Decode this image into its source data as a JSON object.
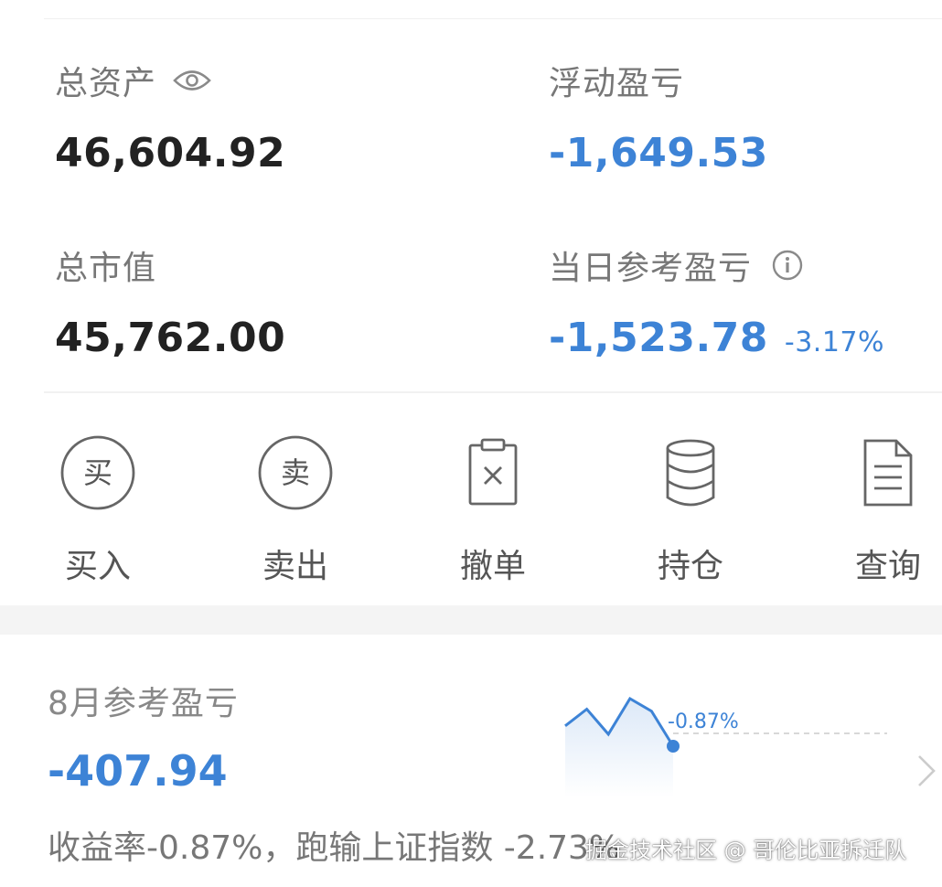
{
  "assets": {
    "total_assets_label": "总资产",
    "total_assets_value": "46,604.92",
    "floating_pl_label": "浮动盈亏",
    "floating_pl_value": "-1,649.53",
    "market_value_label": "总市值",
    "market_value_value": "45,762.00",
    "daily_pl_label": "当日参考盈亏",
    "daily_pl_value": "-1,523.78",
    "daily_pl_pct": "-3.17%"
  },
  "actions": [
    {
      "label": "买入",
      "glyph": "买",
      "icon": "buy-icon"
    },
    {
      "label": "卖出",
      "glyph": "卖",
      "icon": "sell-icon"
    },
    {
      "label": "撤单",
      "icon": "cancel-order-icon"
    },
    {
      "label": "持仓",
      "icon": "database-icon"
    },
    {
      "label": "查询",
      "icon": "document-icon"
    }
  ],
  "monthly": {
    "title": "8月参考盈亏",
    "value": "-407.94",
    "description": "收益率-0.87%，跑输上证指数 -2.73%",
    "chart_label": "-0.87%"
  },
  "watermark": "掘金技术社区 @ 哥伦比亚拆迁队",
  "colors": {
    "accent": "#3d83d6",
    "text": "#222222",
    "muted": "#777777"
  },
  "chart_data": {
    "type": "line",
    "title": "",
    "xlabel": "",
    "ylabel": "",
    "series": [
      {
        "values": [
          0.1,
          0.9,
          -0.3,
          1.4,
          0.8,
          -0.87
        ]
      }
    ],
    "annotations": [
      "-0.87%"
    ],
    "grid": false,
    "legend": "none"
  }
}
